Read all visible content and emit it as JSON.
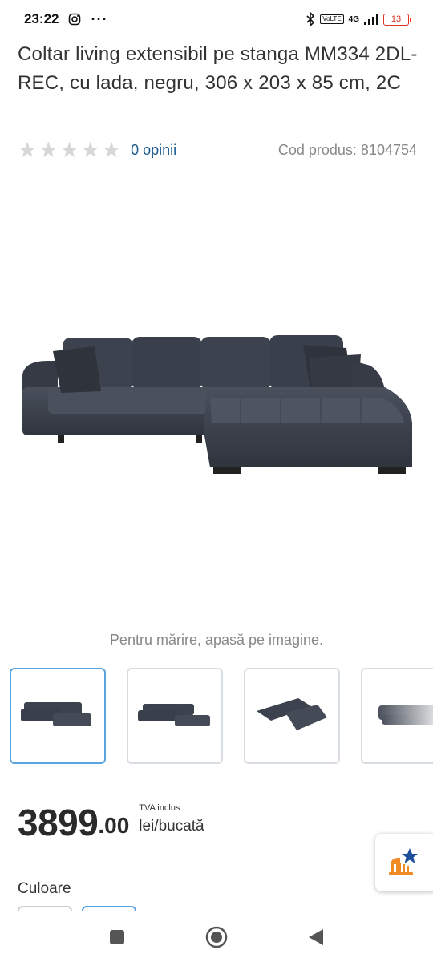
{
  "status": {
    "time": "23:22",
    "battery": "13",
    "network": "4G",
    "volte": "VoLTE"
  },
  "product": {
    "title": "Coltar living extensibil pe stanga MM334 2DL-REC, cu lada, negru, 306 x 203 x 85 cm, 2C",
    "rating_stars": 0,
    "rating_max": 5,
    "reviews": "0 opinii",
    "code": "Cod produs: 8104754"
  },
  "gallery": {
    "hint": "Pentru mărire, apasă pe imagine.",
    "thumbnails": [
      "thumb-1",
      "thumb-2",
      "thumb-3",
      "thumb-4"
    ],
    "active_index": 0
  },
  "price": {
    "integer": "3899",
    "decimal": ".00",
    "tva": "TVA inclus",
    "unit": "lei/bucată"
  },
  "options": {
    "color_label": "Culoare"
  },
  "colors": {
    "accent": "#5aa4e0",
    "link": "#1a5a8f",
    "sofa": "#3b404b"
  }
}
